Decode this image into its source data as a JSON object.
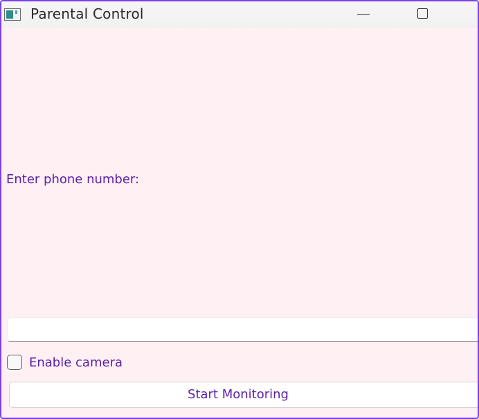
{
  "window": {
    "title": "Parental Control",
    "app_icon": "app-window-icon",
    "controls": {
      "minimize_icon": "minimize-icon",
      "maximize_icon": "maximize-icon"
    }
  },
  "form": {
    "phone_label": "Enter phone number:",
    "phone_value": "",
    "camera_label": "Enable camera",
    "camera_checked": false,
    "start_button_label": "Start Monitoring"
  },
  "colors": {
    "accent_text": "#5a1fa8",
    "window_border": "#7b3ff2",
    "background": "#fff0f3"
  }
}
